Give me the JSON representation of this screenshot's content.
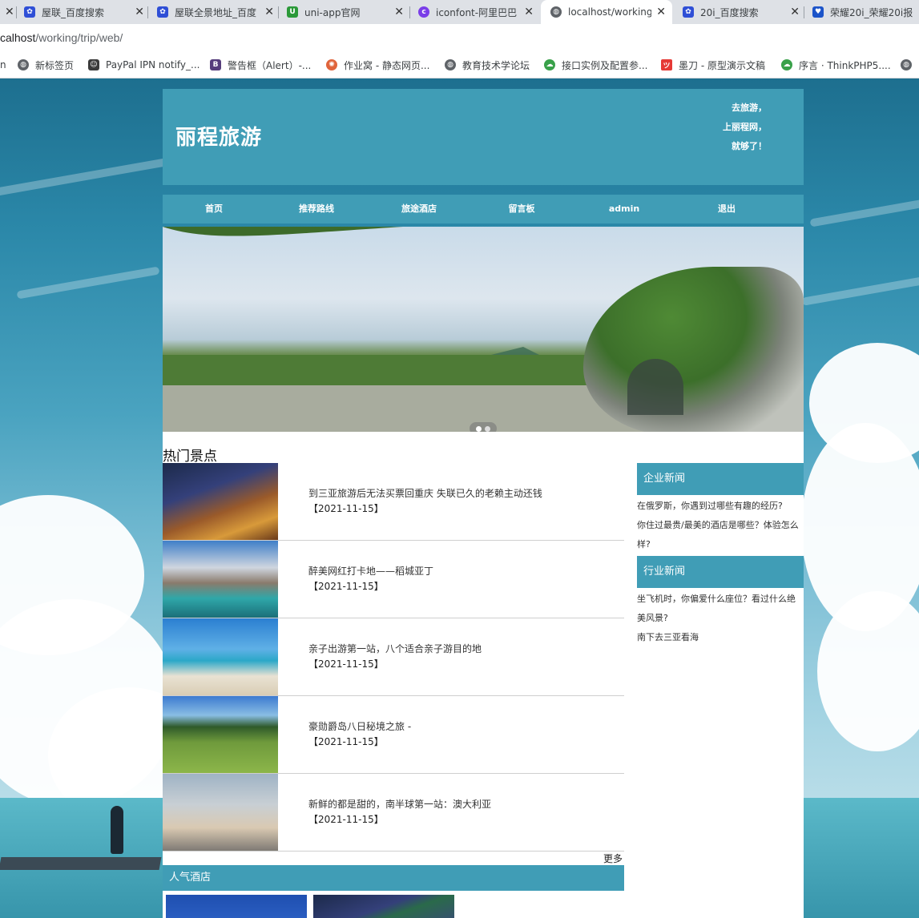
{
  "browser": {
    "tabs": [
      {
        "title": "屋联_百度搜索",
        "icon": "baidu-paw-icon"
      },
      {
        "title": "屋联全景地址_百度",
        "icon": "baidu-paw-icon"
      },
      {
        "title": "uni-app官网",
        "icon": "uniapp-logo-icon"
      },
      {
        "title": "iconfont-阿里巴巴",
        "icon": "iconfont-logo-icon"
      },
      {
        "title": "localhost/working",
        "icon": "globe-icon"
      },
      {
        "title": "20i_百度搜索",
        "icon": "baidu-paw-icon"
      },
      {
        "title": "荣耀20i_荣耀20i报",
        "icon": "honor-logo-icon"
      }
    ],
    "url": {
      "host": "calhost",
      "path": "/working/trip/web/"
    },
    "bookmarks": [
      "n",
      "新标签页",
      "PayPal IPN notify_...",
      "警告框（Alert）-...",
      "作业窝 - 静态网页...",
      "教育技术学论坛",
      "接口实例及配置参...",
      "墨刀 - 原型演示文稿",
      "序言 · ThinkPHP5...."
    ]
  },
  "site": {
    "logo": "丽程旅游",
    "slogan": [
      "去旅游，",
      "上丽程网，",
      "就够了！"
    ],
    "nav": [
      "首页",
      "推荐路线",
      "旅途酒店",
      "留言板",
      "admin",
      "退出"
    ],
    "section_title": "热门景点",
    "news": [
      {
        "title": "到三亚旅游后无法买票回重庆 失联已久的老赖主动还钱",
        "date": "【2021-11-15】"
      },
      {
        "title": "醉美网红打卡地——稻城亚丁",
        "date": "【2021-11-15】"
      },
      {
        "title": "亲子出游第一站，八个适合亲子游目的地",
        "date": "【2021-11-15】"
      },
      {
        "title": "豪勋爵岛八日秘境之旅 -",
        "date": "【2021-11-15】"
      },
      {
        "title": "新鲜的都是甜的，南半球第一站：澳大利亚",
        "date": "【2021-11-15】"
      }
    ],
    "more": "更多",
    "hotel_title": "人气酒店",
    "sidebar": {
      "company_title": "企业新闻",
      "company_links": [
        "在俄罗斯，你遇到过哪些有趣的经历?",
        "你住过最贵/最美的酒店是哪些？体验怎么样?"
      ],
      "industry_title": "行业新闻",
      "industry_links": [
        "坐飞机时，你偏爱什么座位？看过什么绝美风景?",
        "南下去三亚看海"
      ]
    }
  },
  "colors": {
    "accent": "#409db6"
  }
}
